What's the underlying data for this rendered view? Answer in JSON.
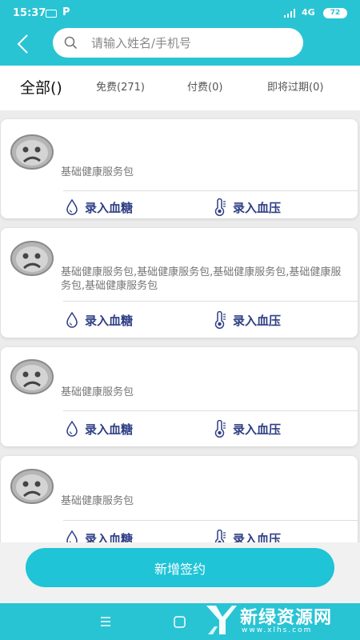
{
  "status_bar": {
    "time": "15:37",
    "app_badge": "P",
    "network": "4G",
    "battery": "72"
  },
  "search": {
    "placeholder": "请输入姓名/手机号",
    "value": ""
  },
  "tabs": [
    {
      "label": "全部()",
      "active": true
    },
    {
      "label": "免费(271)",
      "active": false
    },
    {
      "label": "付费(0)",
      "active": false
    },
    {
      "label": "即将过期(0)",
      "active": false
    }
  ],
  "cards": [
    {
      "packages": "基础健康服务包",
      "actions": {
        "blood_sugar": "录入血糖",
        "blood_pressure": "录入血压"
      }
    },
    {
      "packages": "基础健康服务包,基础健康服务包,基础健康服务包,基础健康服务包,基础健康服务包",
      "actions": {
        "blood_sugar": "录入血糖",
        "blood_pressure": "录入血压"
      }
    },
    {
      "packages": "基础健康服务包",
      "actions": {
        "blood_sugar": "录入血糖",
        "blood_pressure": "录入血压"
      }
    },
    {
      "packages": "基础健康服务包",
      "actions": {
        "blood_sugar": "录入血糖",
        "blood_pressure": "录入血压"
      }
    }
  ],
  "primary_button": {
    "label": "新增签约"
  },
  "watermark": {
    "brand": "新绿资源网",
    "url": "www.xlhs.com"
  },
  "colors": {
    "accent": "#29c4d4",
    "button": "#1fc4d6",
    "action_text": "#2f3f85"
  },
  "icons": {
    "back": "chevron-left-icon",
    "search": "magnifier-icon",
    "blood_sugar": "water-drop-icon",
    "blood_pressure": "thermometer-icon",
    "avatar": "sad-face-icon",
    "nav_menu": "menu-icon",
    "nav_home": "square-home-icon"
  }
}
